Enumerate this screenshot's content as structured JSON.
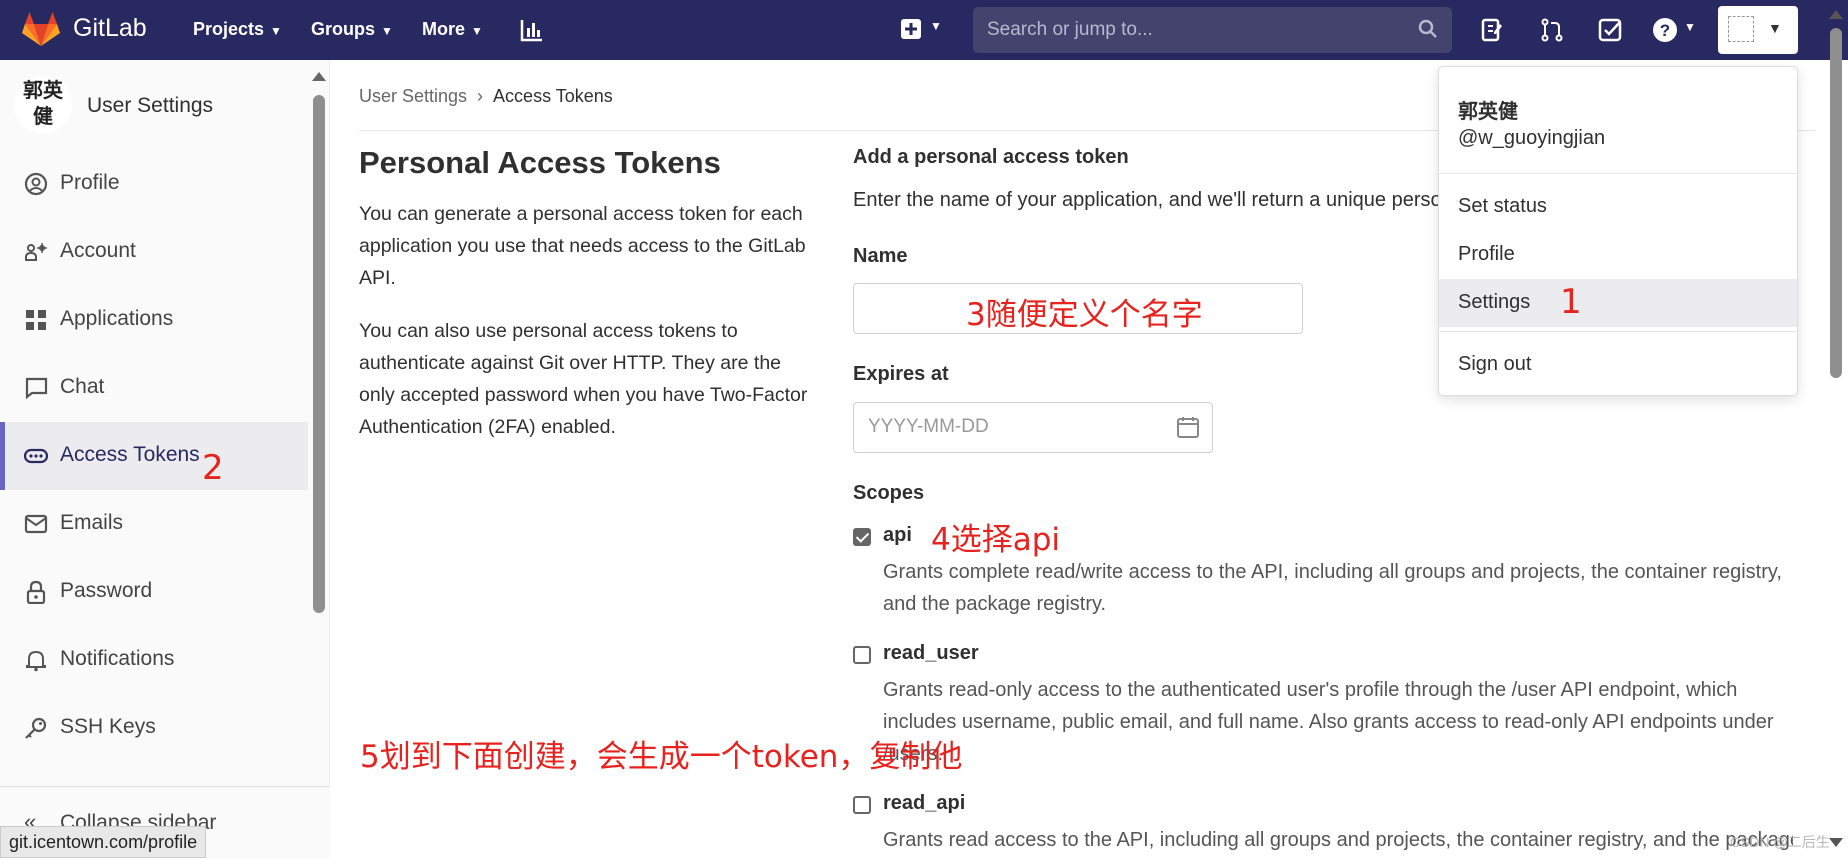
{
  "navbar": {
    "brand": "GitLab",
    "items": [
      {
        "label": "Projects"
      },
      {
        "label": "Groups"
      },
      {
        "label": "More"
      }
    ],
    "search_placeholder": "Search or jump to...",
    "icons": [
      "activity-chart-icon",
      "plus-icon",
      "search-icon",
      "issues-icon",
      "merge-requests-icon",
      "todos-icon",
      "help-icon"
    ]
  },
  "sidebar": {
    "avatar_alt": "郭英健",
    "title": "User Settings",
    "items": [
      {
        "label": "Profile",
        "icon": "profile-icon"
      },
      {
        "label": "Account",
        "icon": "account-icon"
      },
      {
        "label": "Applications",
        "icon": "applications-icon"
      },
      {
        "label": "Chat",
        "icon": "chat-icon"
      },
      {
        "label": "Access Tokens",
        "icon": "access-tokens-icon",
        "active": true
      },
      {
        "label": "Emails",
        "icon": "email-icon"
      },
      {
        "label": "Password",
        "icon": "lock-icon"
      },
      {
        "label": "Notifications",
        "icon": "bell-icon"
      },
      {
        "label": "SSH Keys",
        "icon": "key-icon"
      }
    ],
    "collapse_label": "Collapse sidebar"
  },
  "status_url": "git.icentown.com/profile",
  "breadcrumb": {
    "parent": "User Settings",
    "current": "Access Tokens"
  },
  "main": {
    "title": "Personal Access Tokens",
    "desc1": "You can generate a personal access token for each application you use that needs access to the GitLab API.",
    "desc2": "You can also use personal access tokens to authenticate against Git over HTTP. They are the only accepted password when you have Two-Factor Authentication (2FA) enabled."
  },
  "form": {
    "heading": "Add a personal access token",
    "intro": "Enter the name of your application, and we'll return a unique personal access token.",
    "name_label": "Name",
    "name_value": "",
    "expires_label": "Expires at",
    "expires_placeholder": "YYYY-MM-DD",
    "scopes_label": "Scopes",
    "scopes": [
      {
        "name": "api",
        "checked": true,
        "desc": "Grants complete read/write access to the API, including all groups and projects, the container registry, and the package registry."
      },
      {
        "name": "read_user",
        "checked": false,
        "desc": "Grants read-only access to the authenticated user's profile through the /user API endpoint, which includes username, public email, and full name. Also grants access to read-only API endpoints under /users."
      },
      {
        "name": "read_api",
        "checked": false,
        "desc": "Grants read access to the API, including all groups and projects, the container registry, and the package registry."
      }
    ]
  },
  "dropdown": {
    "user_name": "郭英健",
    "username": "@w_guoyingjian",
    "items": [
      {
        "label": "Set status"
      },
      {
        "label": "Profile"
      },
      {
        "label": "Settings",
        "hover": true
      },
      {
        "label": "Sign out"
      }
    ]
  },
  "annotations": {
    "step1": "1",
    "step2": "2",
    "step3": "3随便定义个名字",
    "step4": "4选择api",
    "step5": "5划到下面创建，会生成一个token，复制他"
  },
  "watermark": "CSDN @二后生",
  "colors": {
    "navbar": "#292961",
    "annotation": "#e6231e",
    "active_bar": "#6666c4"
  }
}
